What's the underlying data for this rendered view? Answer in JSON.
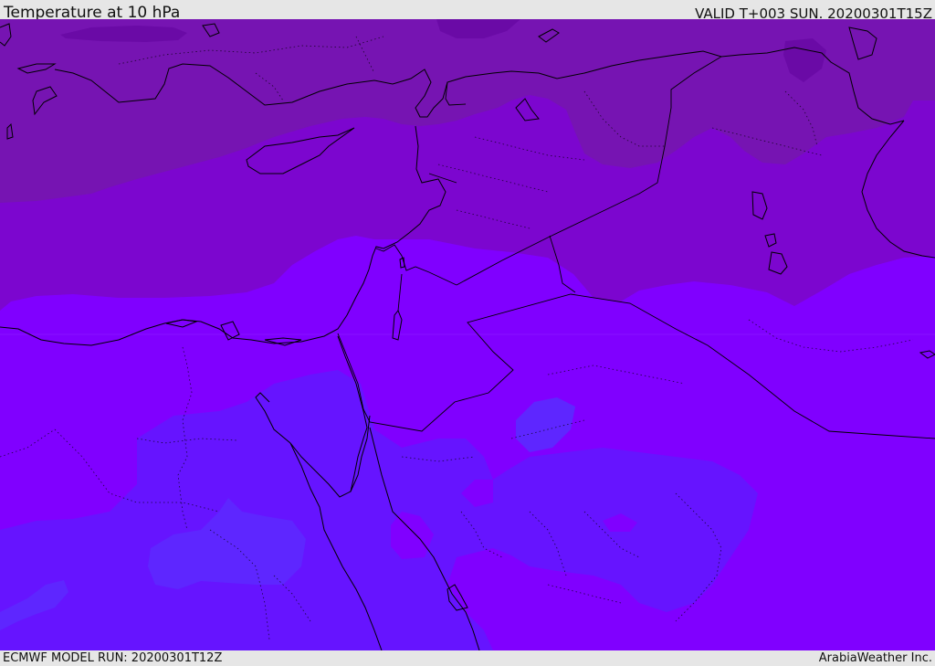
{
  "header": {
    "title": "Temperature at 10 hPa",
    "valid": "VALID T+003 SUN. 20200301T15Z"
  },
  "footer": {
    "model_run": "ECMWF MODEL RUN: 20200301T12Z",
    "credit": "ArabiaWeather Inc."
  },
  "map": {
    "colors": {
      "darkest": "#6a0aa6",
      "dark": "#7614b2",
      "mid": "#7c06cf",
      "bright": "#8000ff",
      "blue": "#6614ff",
      "lightblue": "#5e26ff",
      "border": "#000000"
    },
    "icons": [
      "coastline",
      "country-border",
      "province-border"
    ]
  }
}
